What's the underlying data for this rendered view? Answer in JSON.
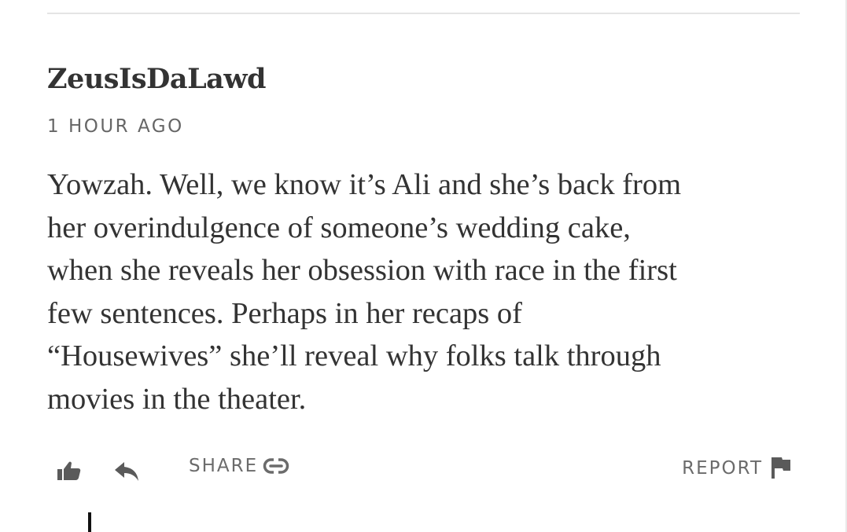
{
  "comment": {
    "author": "ZeusIsDaLawd",
    "timestamp": "1 HOUR AGO",
    "body_lines": [
      "Yowzah. Well, we know it’s Ali and she’s back from",
      "her overindulgence of someone’s wedding cake,",
      "when she reveals her obsession with race in the first",
      "few sentences. Perhaps in her recaps of",
      "“Housewives” she’ll reveal why folks talk through",
      "movies in the theater."
    ]
  },
  "actions": {
    "like_icon": "thumbs-up-icon",
    "reply_icon": "reply-arrow-icon",
    "share_label": "SHARE",
    "share_icon": "link-icon",
    "report_label": "REPORT",
    "report_icon": "flag-icon"
  },
  "colors": {
    "text": "#333333",
    "muted": "#666666",
    "divider": "#e4e4e4"
  }
}
